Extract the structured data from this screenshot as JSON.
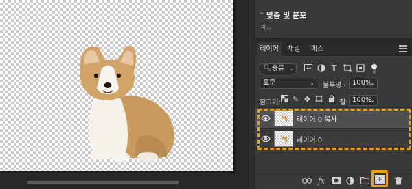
{
  "properties": {
    "section_title": "맞춤 및 분포",
    "section_sub": "마…"
  },
  "tabs": [
    "레이어",
    "채널",
    "패스"
  ],
  "filter": {
    "kind_label": "종류",
    "icons": [
      "image-filter-icon",
      "adjustment-filter-icon",
      "type-filter-icon",
      "shape-filter-icon",
      "smart-object-filter-icon"
    ]
  },
  "blend": {
    "mode": "표준",
    "opacity_label": "불투명도:",
    "opacity_value": "100%"
  },
  "lock": {
    "label": "잠그기:",
    "fill_label": "칠:",
    "fill_value": "100%"
  },
  "layers": [
    {
      "name": "레이어 0 복사",
      "selected": true,
      "visible": true
    },
    {
      "name": "레이어 0",
      "selected": false,
      "visible": true
    }
  ],
  "bottom_icons": [
    "link-icon",
    "fx-icon",
    "mask-icon",
    "adjustment-icon",
    "group-folder-icon",
    "new-layer-icon",
    "trash-icon"
  ],
  "bottom": {
    "fx_label": "fx"
  },
  "colors": {
    "highlight": "#f0a000",
    "panel_bg": "#383838",
    "selected_layer": "#4f4f4f"
  }
}
